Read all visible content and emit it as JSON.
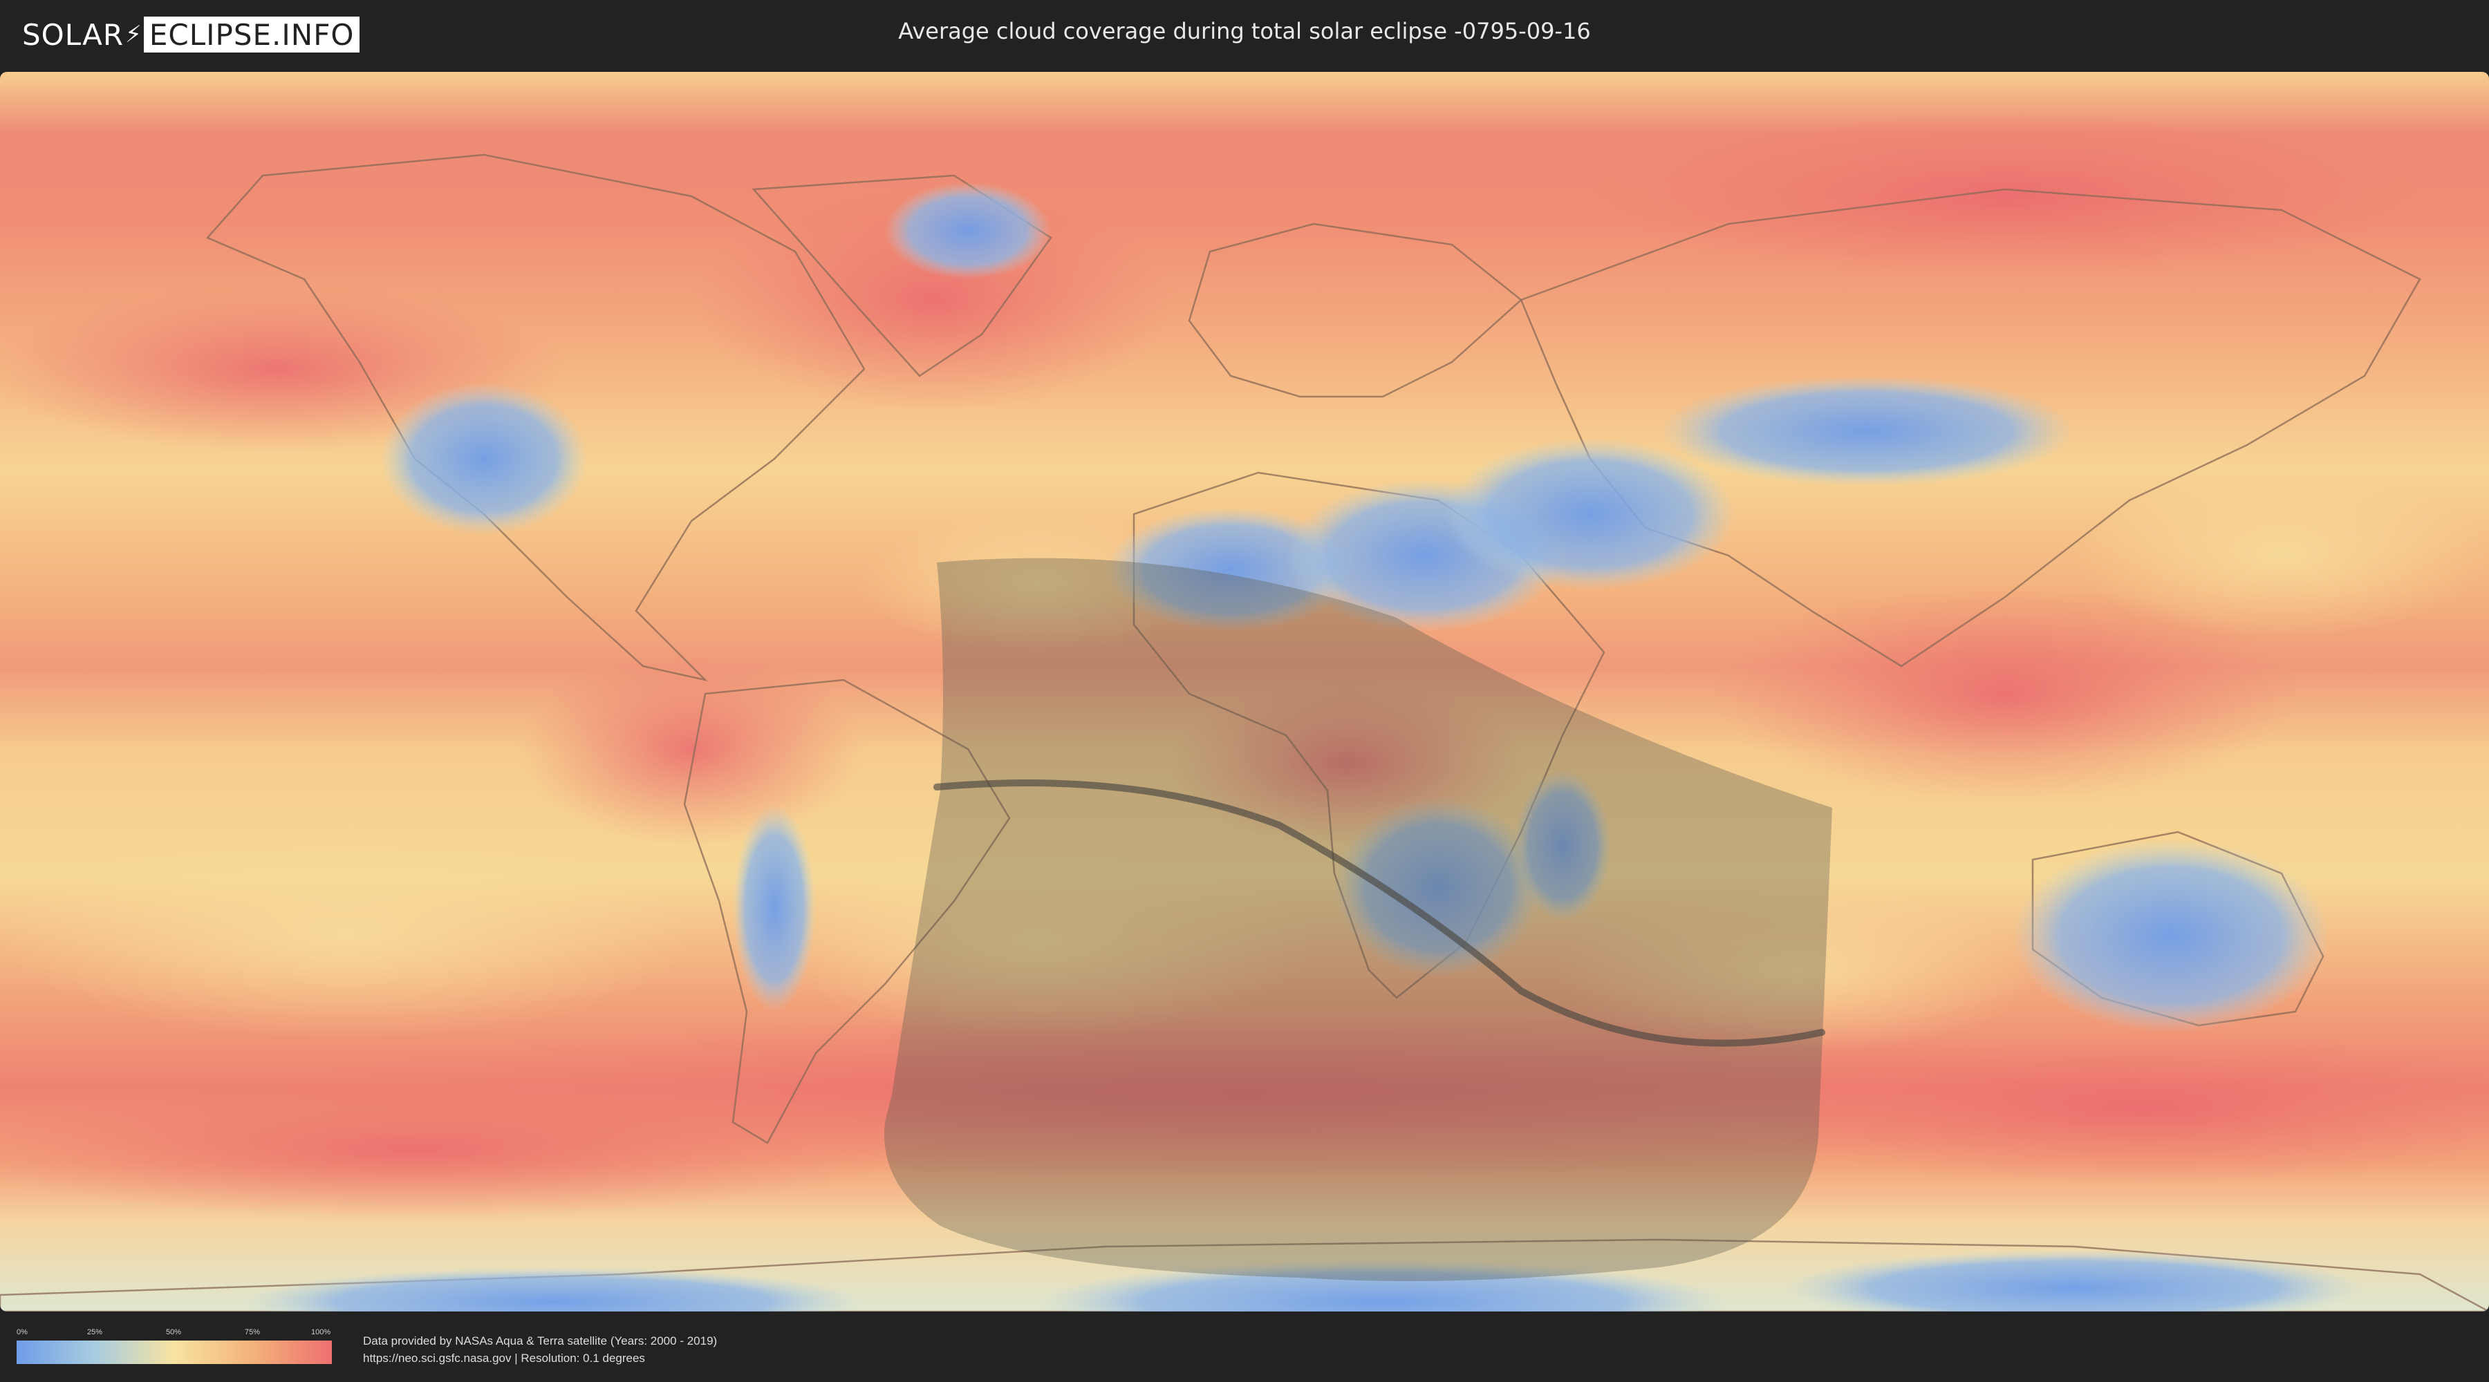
{
  "header": {
    "logo": {
      "word1": "SOLAR",
      "word2": "ECLIPSE.INFO",
      "separator_icon": "lightning-bolt-icon"
    },
    "title": "Average cloud coverage during total solar eclipse -0795-09-16"
  },
  "map": {
    "projection": "equirectangular",
    "layer": "average cloud coverage",
    "eclipse_overlay": {
      "shown": true,
      "central_line_shown": true
    },
    "colors": {
      "low": "#6f9de8",
      "low_mid": "#a9cde0",
      "mid": "#f7e3a0",
      "mid_high": "#f3b27a",
      "high": "#ee7070",
      "land_outline": "#8a6a55",
      "shadow_overlay": "#5a5a4e",
      "central_line": "#4a4740"
    }
  },
  "legend": {
    "ticks": [
      "0%",
      "25%",
      "50%",
      "75%",
      "100%"
    ]
  },
  "credits": {
    "line1": "Data provided by NASAs Aqua & Terra satellite (Years: 2000 - 2019)",
    "line2": "https://neo.sci.gsfc.nasa.gov | Resolution: 0.1 degrees"
  }
}
